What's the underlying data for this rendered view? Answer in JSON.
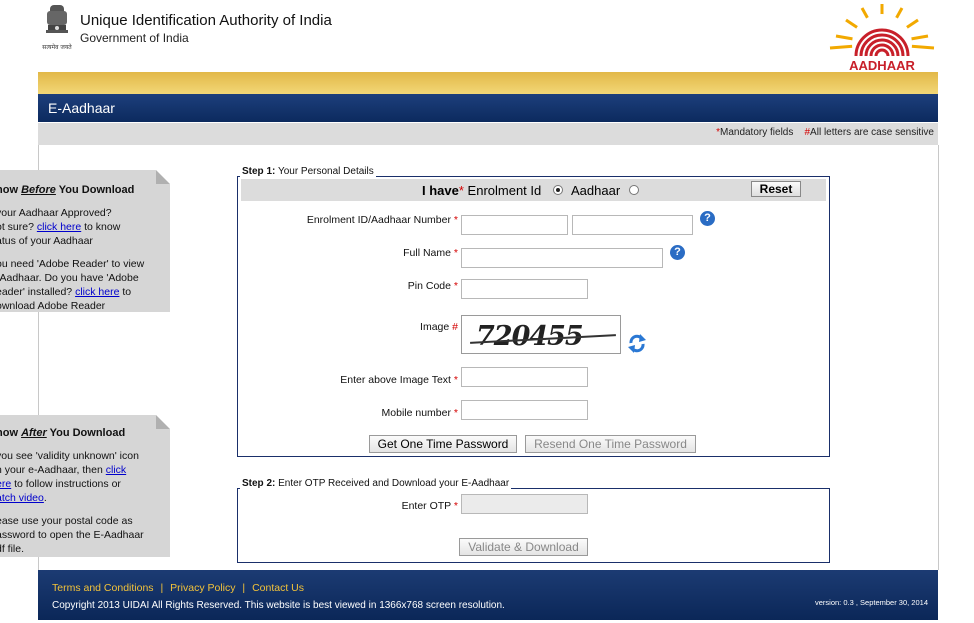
{
  "header": {
    "org_name": "Unique Identification Authority of India",
    "gov_name": "Government of India",
    "emblem_caption": "सत्यमेव जयते",
    "logo_text": "AADHAAR"
  },
  "app": {
    "title": "E-Aadhaar"
  },
  "notice": {
    "mandatory_marker": "*",
    "mandatory_label": "Mandatory fields",
    "case_marker": "#",
    "case_label": "All letters are case sensitive"
  },
  "side_notes": {
    "before": {
      "heading_pre": "now ",
      "heading_em": "Before",
      "heading_post": " You Download",
      "p1_pre": " your Aadhaar Approved?\not sure? ",
      "p1_link": "click here",
      "p1_post": " to know\natus of your Aadhaar",
      "p2_pre": "ou need 'Adobe Reader' to view\n-Aadhaar. Do you have 'Adobe\neader' installed? ",
      "p2_link": "click here",
      "p2_post": " to\nownload Adobe Reader"
    },
    "after": {
      "heading_pre": "now ",
      "heading_em": "After",
      "heading_post": " You Download",
      "p1_pre": "you see 'validity unknown' icon\nn your e-Aadhaar, then ",
      "p1_link": "click\nere",
      "p1_post": " to follow instructions or\n",
      "p1_link2": "atch video",
      "p1_end": ".",
      "p2": "ease use your postal code as\nassword to open the E-Aadhaar\ndf file."
    }
  },
  "step1": {
    "legend_bold": "Step 1:",
    "legend_text": " Your Personal Details",
    "i_have": "I have",
    "i_have_star": "*",
    "option_enrolment": "Enrolment Id",
    "option_aadhaar": "Aadhaar",
    "selected_option": "Enrolment Id",
    "reset_label": "Reset",
    "enrolment_label": "Enrolment ID/Aadhaar Number",
    "enrolment_value_1": "",
    "enrolment_value_2": "",
    "full_name_label": "Full Name",
    "full_name_value": "",
    "pin_label": "Pin Code",
    "pin_value": "",
    "image_label": "Image",
    "image_marker": "#",
    "captcha_text": "720455",
    "image_text_label": "Enter above Image Text",
    "image_text_value": "",
    "mobile_label": "Mobile number",
    "mobile_value": "",
    "star": "*",
    "get_otp_label": "Get One Time Password",
    "resend_otp_label": "Resend One Time Password"
  },
  "step2": {
    "legend_bold": "Step 2:",
    "legend_text": " Enter OTP Received and Download your E-Aadhaar",
    "otp_label": "Enter OTP",
    "otp_value": "",
    "validate_label": "Validate & Download"
  },
  "footer": {
    "links": [
      "Terms and Conditions",
      "Privacy Policy",
      "Contact Us"
    ],
    "separator": "|",
    "copyright": "Copyright 2013 UIDAI All Rights Reserved. This website is best viewed in 1366x768 screen resolution.",
    "version": "version: 0.3 , September 30, 2014"
  },
  "colors": {
    "header_blue": "#0c2a5e",
    "gold_bar": "#e8c45a",
    "mandatory_red": "#d40000",
    "footer_link": "#f2c23a",
    "logo_red": "#c8202a",
    "logo_gold": "#f2a900"
  }
}
